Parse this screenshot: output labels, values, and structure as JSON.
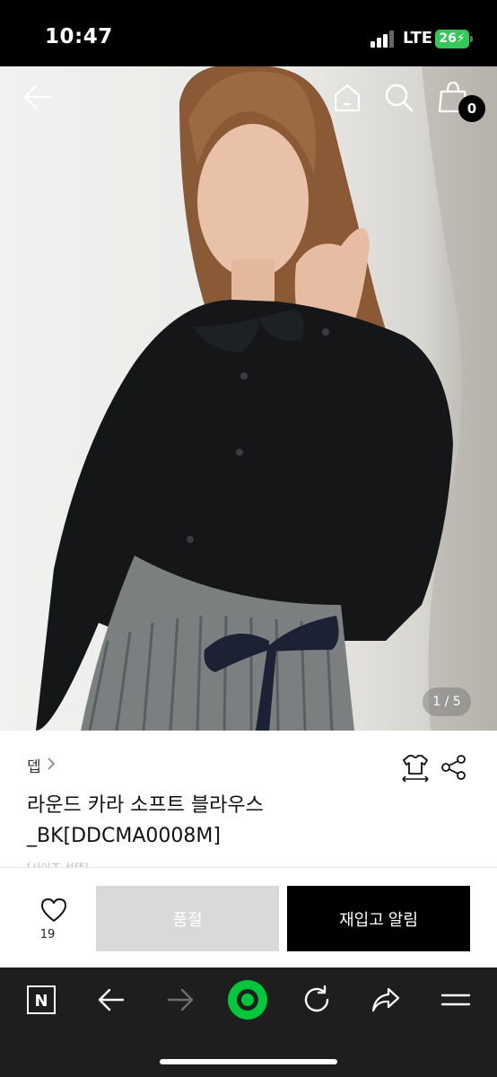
{
  "status_bar": {
    "time": "10:47",
    "network": "LTE",
    "battery": "26"
  },
  "hero": {
    "page_indicator": "1 / 5",
    "cart_count": "0"
  },
  "product": {
    "brand": "뎁",
    "name_line1": "라운드 카라 소프트 블라우스",
    "name_line2": "_BK[DDCMA0008M]",
    "partial_text": "[사이즈 선택]"
  },
  "purchase": {
    "like_count": "19",
    "soldout_label": "품절",
    "restock_label": "재입고 알림"
  },
  "browser": {
    "tab_icon_letter": "N"
  },
  "colors": {
    "accent_green": "#00c73c",
    "dark_bar": "#1e1e1e",
    "battery": "#34c759"
  },
  "icons": [
    "back-arrow-icon",
    "home-icon",
    "search-icon",
    "cart-icon",
    "size-guide-icon",
    "share-icon",
    "heart-icon"
  ]
}
